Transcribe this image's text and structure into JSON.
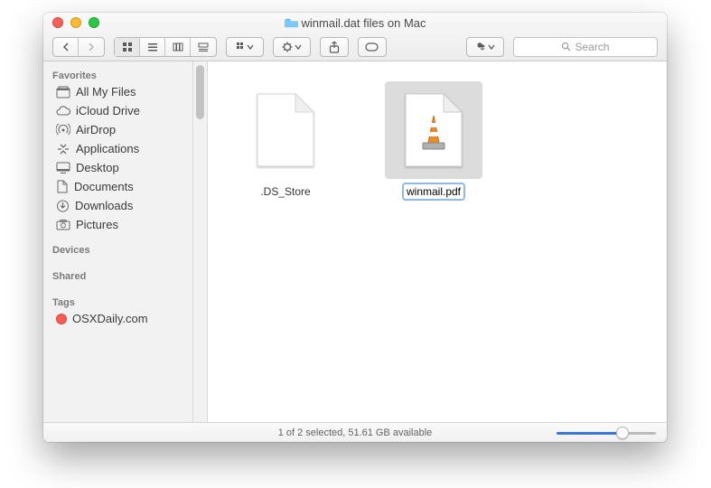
{
  "window": {
    "title": "winmail.dat files on Mac"
  },
  "search": {
    "placeholder": "Search"
  },
  "sidebar": {
    "sections": {
      "favorites": "Favorites",
      "devices": "Devices",
      "shared": "Shared",
      "tags": "Tags"
    },
    "favorites": [
      {
        "label": "All My Files"
      },
      {
        "label": "iCloud Drive"
      },
      {
        "label": "AirDrop"
      },
      {
        "label": "Applications"
      },
      {
        "label": "Desktop"
      },
      {
        "label": "Documents"
      },
      {
        "label": "Downloads"
      },
      {
        "label": "Pictures"
      }
    ],
    "tags": [
      {
        "label": "OSXDaily.com",
        "color": "#ff5b52"
      }
    ]
  },
  "files": [
    {
      "name": ".DS_Store",
      "selected": false,
      "kind": "blank"
    },
    {
      "name": "winmail.pdf",
      "selected": true,
      "kind": "vlc"
    }
  ],
  "status": {
    "text": "1 of 2 selected, 51.61 GB available"
  }
}
